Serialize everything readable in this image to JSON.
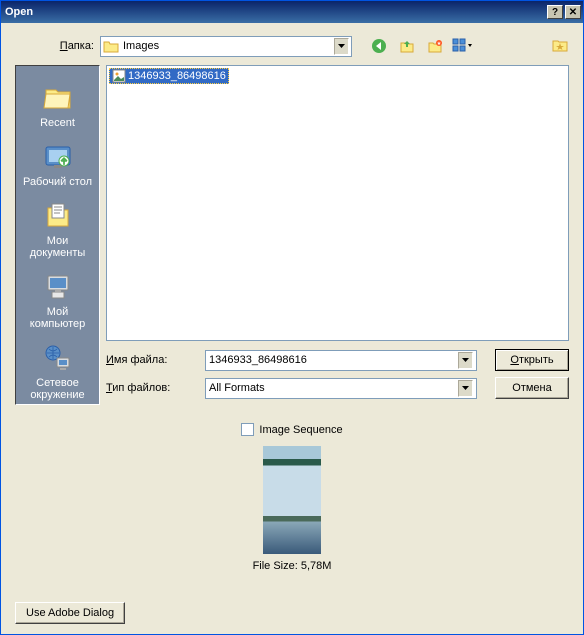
{
  "title": "Open",
  "folder_label": "Папка:",
  "folder_value": "Images",
  "sidebar": [
    {
      "label": "Recent"
    },
    {
      "label": "Рабочий стол"
    },
    {
      "label": "Мои\nдокументы"
    },
    {
      "label": "Мой\nкомпьютер"
    },
    {
      "label": "Сетевое\nокружение"
    }
  ],
  "file_item": "1346933_86498616",
  "filename_label": "Имя файла:",
  "filename_value": "1346933_86498616",
  "filetype_label": "Тип файлов:",
  "filetype_value": "All Formats",
  "open_btn": "Открыть",
  "cancel_btn": "Отмена",
  "image_sequence": "Image Sequence",
  "filesize": "File Size: 5,78M",
  "adobe_btn": "Use Adobe Dialog"
}
